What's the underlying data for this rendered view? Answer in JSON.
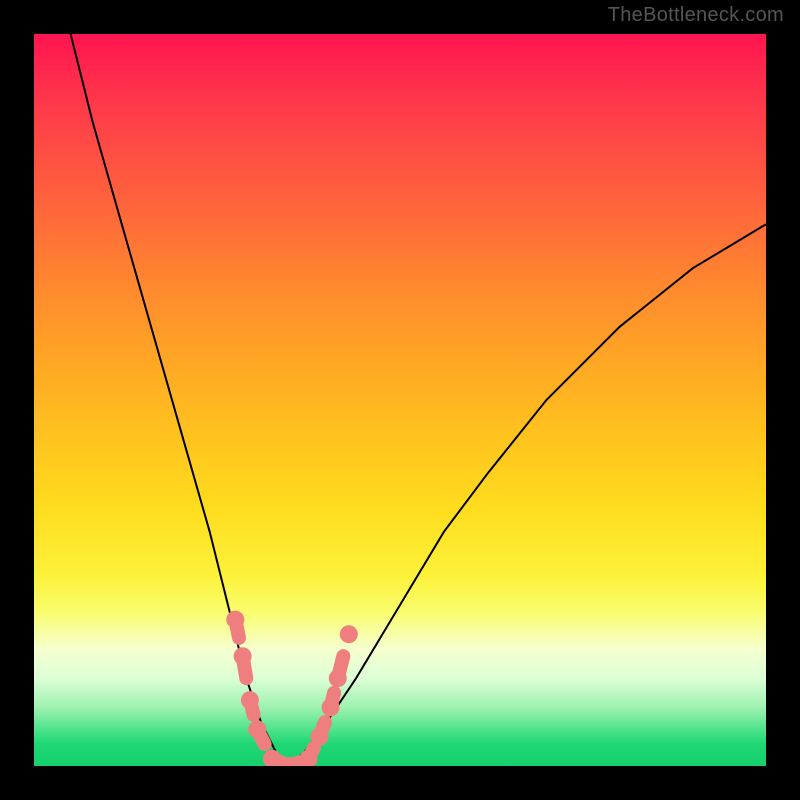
{
  "watermark": "TheBottleneck.com",
  "colors": {
    "background": "#000000",
    "gradient_top": "#ff1450",
    "gradient_mid": "#ffdd1e",
    "gradient_bottom": "#17d16e",
    "curve": "#000000",
    "markers": "#ef7f7f"
  },
  "chart_data": {
    "type": "line",
    "title": "",
    "xlabel": "",
    "ylabel": "",
    "xlim": [
      0,
      100
    ],
    "ylim": [
      0,
      100
    ],
    "grid": false,
    "legend": false,
    "series": [
      {
        "name": "bottleneck-curve",
        "x": [
          5,
          8,
          12,
          16,
          20,
          24,
          27,
          29,
          31,
          33,
          35,
          37,
          40,
          44,
          50,
          56,
          62,
          70,
          80,
          90,
          100
        ],
        "y": [
          100,
          88,
          74,
          60,
          46,
          32,
          20,
          12,
          6,
          2,
          0,
          2,
          6,
          12,
          22,
          32,
          40,
          50,
          60,
          68,
          74
        ]
      }
    ],
    "markers": [
      {
        "x": 27.5,
        "y": 20
      },
      {
        "x": 28.5,
        "y": 15
      },
      {
        "x": 29.5,
        "y": 9
      },
      {
        "x": 30.5,
        "y": 5
      },
      {
        "x": 32.5,
        "y": 1
      },
      {
        "x": 35.0,
        "y": 0
      },
      {
        "x": 37.5,
        "y": 1
      },
      {
        "x": 39.0,
        "y": 4
      },
      {
        "x": 40.5,
        "y": 8
      },
      {
        "x": 41.5,
        "y": 12
      },
      {
        "x": 43.0,
        "y": 18
      }
    ],
    "annotations": []
  }
}
